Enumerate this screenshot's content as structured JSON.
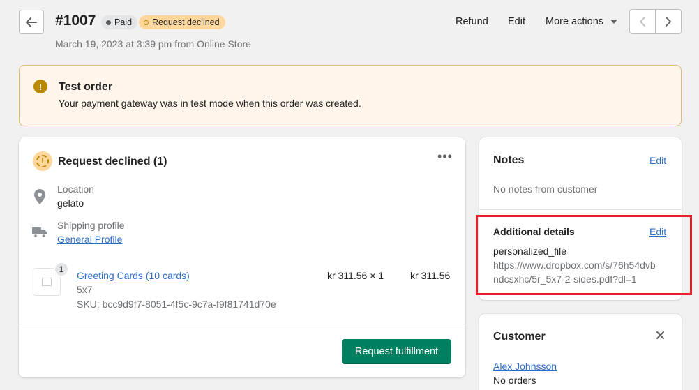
{
  "header": {
    "order_number": "#1007",
    "badges": {
      "paid": "Paid",
      "declined": "Request declined"
    },
    "subtitle": "March 19, 2023 at 3:39 pm from Online Store",
    "actions": {
      "refund": "Refund",
      "edit": "Edit",
      "more": "More actions"
    }
  },
  "banner": {
    "title": "Test order",
    "text": "Your payment gateway was in test mode when this order was created."
  },
  "fulfillment": {
    "title": "Request declined (1)",
    "location_label": "Location",
    "location_value": "gelato",
    "shipping_label": "Shipping profile",
    "shipping_value": "General Profile",
    "item": {
      "quantity": "1",
      "name": "Greeting Cards (10 cards)",
      "variant": "5x7",
      "sku": "SKU: bcc9d9f7-8051-4f5c-9c7a-f9f81741d70e",
      "unit_price": "kr 311.56 × 1",
      "total": "kr 311.56"
    },
    "button": "Request fulfillment"
  },
  "notes": {
    "title": "Notes",
    "edit": "Edit",
    "text": "No notes from customer"
  },
  "additional": {
    "title": "Additional details",
    "edit": "Edit",
    "key": "personalized_file",
    "value_line1": "https://www.dropbox.com/s/76h54dvb",
    "value_line2": "ndcsxhc/5r_5x7-2-sides.pdf?dl=1"
  },
  "customer": {
    "title": "Customer",
    "name": "Alex Johnsson",
    "orders": "No orders"
  },
  "colors": {
    "primary_button": "#008060",
    "link": "#2c6ecb",
    "warning_bg": "#fff5ea",
    "highlight": "#e8202a"
  }
}
